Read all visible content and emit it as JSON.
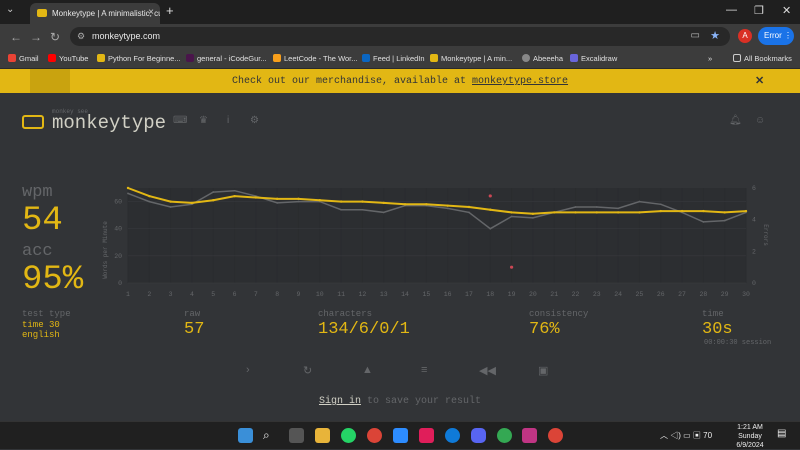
{
  "browser": {
    "tab_title": "Monkeytype | A minimalistic, cu",
    "url": "monkeytype.com",
    "profile_initial": "A",
    "error_label": "Error",
    "bookmarks": [
      "Gmail",
      "YouTube",
      "Python For Beginne...",
      "general - iCodeGur...",
      "LeetCode - The Wor...",
      "Feed | LinkedIn",
      "Monkeytype | A min...",
      "Abeeeha",
      "Excalidraw"
    ],
    "all_bookmarks": "All Bookmarks"
  },
  "banner": {
    "text": "Check out our merchandise, available at ",
    "link": "monkeytype.store"
  },
  "header": {
    "brand_small": "monkey see",
    "brand": "monkeytype"
  },
  "result": {
    "wpm_label": "wpm",
    "wpm": "54",
    "acc_label": "acc",
    "acc": "95%",
    "test_type_label": "test type",
    "test_type_line1": "time 30",
    "test_type_line2": "english",
    "raw_label": "raw",
    "raw": "57",
    "characters_label": "characters",
    "characters": "134/6/0/1",
    "consistency_label": "consistency",
    "consistency": "76%",
    "time_label": "time",
    "time": "30s",
    "session": "00:00:30 session"
  },
  "chart_data": {
    "type": "line",
    "ylabel": "Words per Minute",
    "y2label": "Errors",
    "x": [
      1,
      2,
      3,
      4,
      5,
      6,
      7,
      8,
      9,
      10,
      11,
      12,
      13,
      14,
      15,
      16,
      17,
      18,
      19,
      20,
      21,
      22,
      23,
      24,
      25,
      26,
      27,
      28,
      29,
      30
    ],
    "ylim": [
      0,
      70
    ],
    "y2lim": [
      0,
      6
    ],
    "y_ticks": [
      0,
      20,
      40,
      60
    ],
    "y2_ticks": [
      0,
      2,
      4,
      6
    ],
    "series": [
      {
        "color": "#e2b714",
        "values": [
          70,
          64,
          60,
          59,
          61,
          64,
          63,
          62,
          62,
          61,
          60,
          60,
          59,
          58,
          58,
          57,
          56,
          54,
          52,
          51,
          52,
          52,
          52,
          52,
          52,
          53,
          53,
          53,
          52,
          53
        ]
      },
      {
        "color": "#646669",
        "values": [
          66,
          60,
          56,
          58,
          67,
          68,
          64,
          59,
          60,
          60,
          54,
          54,
          52,
          57,
          57,
          55,
          52,
          40,
          49,
          48,
          52,
          56,
          56,
          55,
          60,
          58,
          52,
          45,
          46,
          52
        ]
      },
      {
        "color": "#ca4754",
        "values": [
          null,
          null,
          null,
          null,
          null,
          null,
          null,
          null,
          null,
          null,
          null,
          null,
          null,
          null,
          null,
          null,
          null,
          5.5,
          1.0,
          null,
          null,
          null,
          null,
          null,
          null,
          null,
          null,
          null,
          null,
          null
        ]
      }
    ]
  },
  "taskbar": {
    "temp": "70",
    "time": "1:21 AM",
    "day": "Sunday",
    "date": "6/9/2024"
  }
}
